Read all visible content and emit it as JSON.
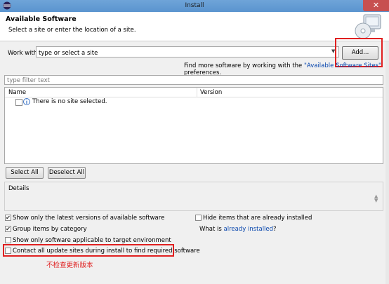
{
  "window": {
    "title": "Install",
    "close_glyph": "✕"
  },
  "header": {
    "title": "Available Software",
    "description": "Select a site or enter the location of a site."
  },
  "work_with": {
    "label": "Work with:",
    "placeholder": "type or select a site",
    "add_label": "Add...",
    "find_more_prefix": "Find more software by working with the ",
    "find_more_link": "\"Available Software Sites\"",
    "find_more_suffix": " preferences."
  },
  "filter": {
    "placeholder": "type filter text"
  },
  "table": {
    "columns": [
      "Name",
      "Version"
    ],
    "empty_message": "There is no site selected."
  },
  "buttons": {
    "select_all": "Select All",
    "deselect_all": "Deselect All"
  },
  "details": {
    "label": "Details"
  },
  "options": {
    "latest_versions": {
      "label": "Show only the latest versions of available software",
      "checked": true
    },
    "group_by_category": {
      "label": "Group items by category",
      "checked": true
    },
    "applicable_only": {
      "label": "Show only software applicable to target environment",
      "checked": false
    },
    "contact_update_sites": {
      "label": "Contact all update sites during install to find required software",
      "checked": false
    },
    "hide_installed": {
      "label": "Hide items that are already installed",
      "checked": false
    },
    "what_is_prefix": "What is ",
    "what_is_link": "already installed",
    "what_is_suffix": "?"
  },
  "annotation": {
    "note": "不检查更新版本"
  },
  "colors": {
    "titlebar": "#5a94cf",
    "close": "#c75050",
    "highlight": "#e02020",
    "link": "#0645ad"
  },
  "icons": [
    "eclipse-icon",
    "close-icon",
    "cd-install-icon",
    "dropdown-arrow-icon",
    "info-icon",
    "spinner-icon"
  ]
}
